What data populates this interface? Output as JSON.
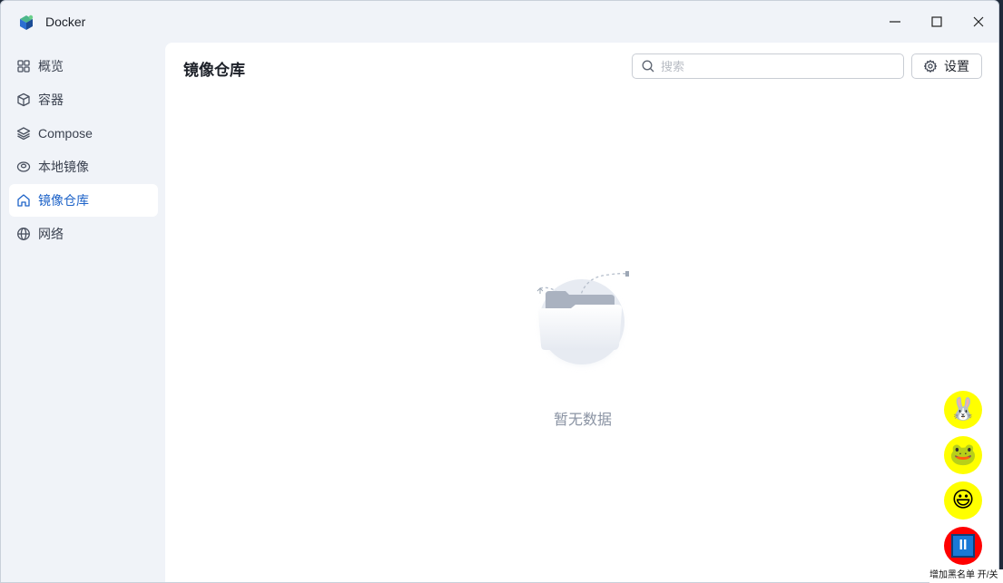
{
  "window": {
    "title": "Docker",
    "controls": {
      "minimize": "minimize-icon",
      "maximize": "maximize-icon",
      "close": "close-icon"
    }
  },
  "sidebar": {
    "items": [
      {
        "label": "概览",
        "icon": "grid-icon",
        "active": false
      },
      {
        "label": "容器",
        "icon": "cube-icon",
        "active": false
      },
      {
        "label": "Compose",
        "icon": "layers-icon",
        "active": false
      },
      {
        "label": "本地镜像",
        "icon": "disk-icon",
        "active": false
      },
      {
        "label": "镜像仓库",
        "icon": "home-icon",
        "active": true
      },
      {
        "label": "网络",
        "icon": "globe-icon",
        "active": false
      }
    ]
  },
  "main": {
    "title": "镜像仓库",
    "search": {
      "placeholder": "搜索",
      "value": ""
    },
    "settings_label": "设置",
    "empty_text": "暂无数据"
  },
  "overlay": {
    "buttons": [
      {
        "glyph": "🐰",
        "icon": "rabbit-icon",
        "color": "#ffff00"
      },
      {
        "glyph": "🐸",
        "icon": "frog-icon",
        "color": "#ffff00"
      },
      {
        "glyph": "😃",
        "icon": "smiley-icon",
        "color": "#ffff00"
      },
      {
        "glyph": "II",
        "icon": "pause-icon",
        "color": "#ff0000"
      }
    ],
    "blacklist_label": "增加黑名单 开/关"
  },
  "colors": {
    "accent": "#1e63c8",
    "sidebar_bg": "#f0f3f8",
    "content_bg": "#ffffff"
  }
}
